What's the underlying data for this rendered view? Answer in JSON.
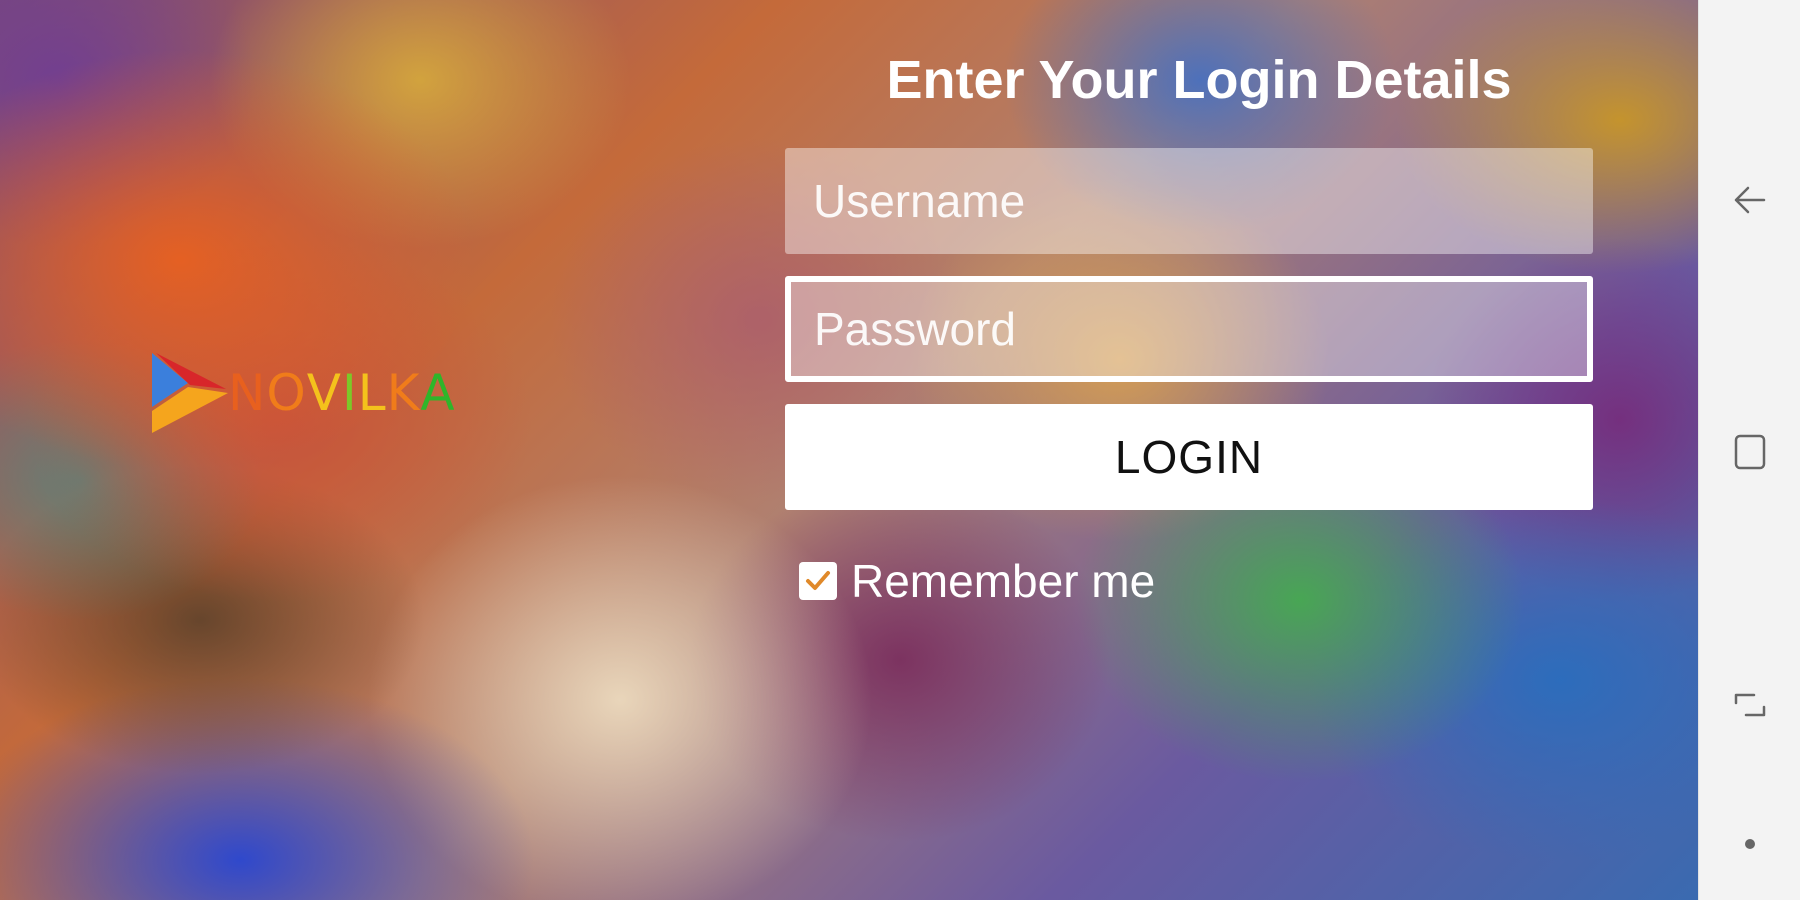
{
  "logo": {
    "letters": [
      {
        "char": "N",
        "color": "#e8601e"
      },
      {
        "char": "O",
        "color": "#f07c1a"
      },
      {
        "char": "V",
        "color": "#f4c21c"
      },
      {
        "char": "I",
        "color": "#7cc828"
      },
      {
        "char": "L",
        "color": "#f4c21c"
      },
      {
        "char": "K",
        "color": "#f07c1a"
      },
      {
        "char": "A",
        "color": "#2fb52a"
      }
    ],
    "mark_colors": [
      "#3b7fdc",
      "#d8262a",
      "#f5a51d"
    ]
  },
  "form": {
    "title": "Enter Your Login Details",
    "username_placeholder": "Username",
    "password_placeholder": "Password",
    "login_label": "LOGIN",
    "remember_label": "Remember me",
    "remember_checked": true
  },
  "navbar": {
    "icons": [
      "back-icon",
      "home-icon",
      "recents-icon",
      "dot-icon"
    ]
  }
}
